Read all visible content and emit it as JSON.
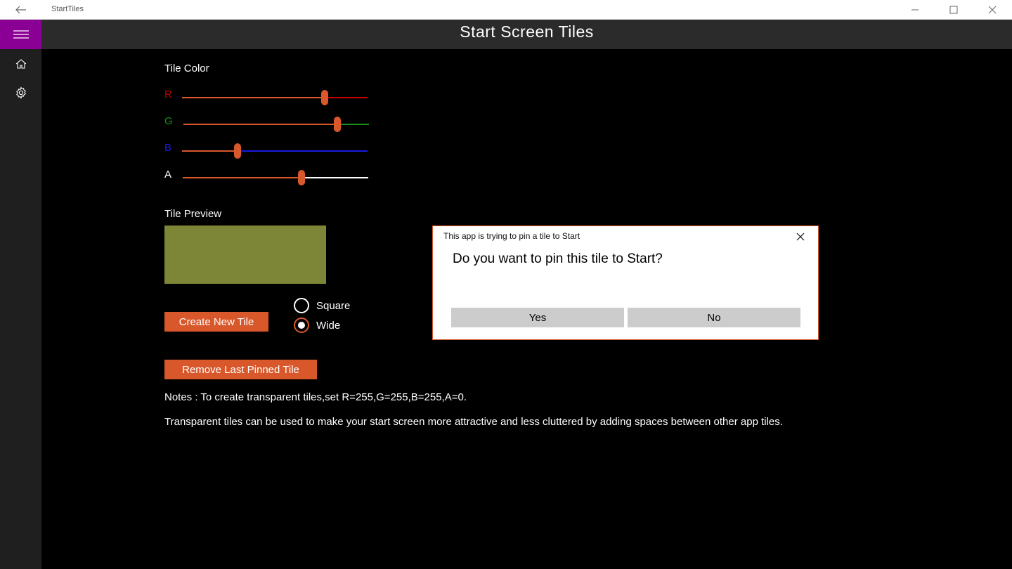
{
  "window": {
    "title": "StartTiles",
    "back_icon": "back-arrow-icon",
    "minimize_icon": "minimize-icon",
    "maximize_icon": "maximize-icon",
    "close_icon": "close-icon"
  },
  "header": {
    "title": "Start Screen Tiles",
    "menu_icon": "hamburger-icon",
    "accent": "#8b0094"
  },
  "sidebar": {
    "items": [
      {
        "icon": "home-icon"
      },
      {
        "icon": "gear-icon"
      }
    ]
  },
  "tile_color": {
    "label": "Tile Color",
    "sliders": [
      {
        "letter": "R",
        "color": "#c00000",
        "value_fraction": 0.77
      },
      {
        "letter": "G",
        "color": "#1a8f1a",
        "value_fraction": 0.83
      },
      {
        "letter": "B",
        "color": "#1a1ae0",
        "value_fraction": 0.3
      },
      {
        "letter": "A",
        "color": "#ffffff",
        "value_fraction": 0.64
      }
    ],
    "thumb_color": "#d9582b"
  },
  "tile_preview": {
    "label": "Tile Preview",
    "color": "#7d8636"
  },
  "buttons": {
    "create_new_tile": "Create New Tile",
    "remove_last_pinned_tile": "Remove Last Pinned Tile"
  },
  "size_options": [
    {
      "label": "Square",
      "checked": false
    },
    {
      "label": "Wide",
      "checked": true
    }
  ],
  "notes": {
    "line1": "Notes : To create transparent tiles,set R=255,G=255,B=255,A=0.",
    "line2": "Transparent tiles can be used to make your start screen more attractive and less cluttered by adding spaces between other app tiles."
  },
  "dialog": {
    "title": "This app is trying to pin a tile to Start",
    "message": "Do you want to pin this tile to Start?",
    "yes_label": "Yes",
    "no_label": "No"
  }
}
